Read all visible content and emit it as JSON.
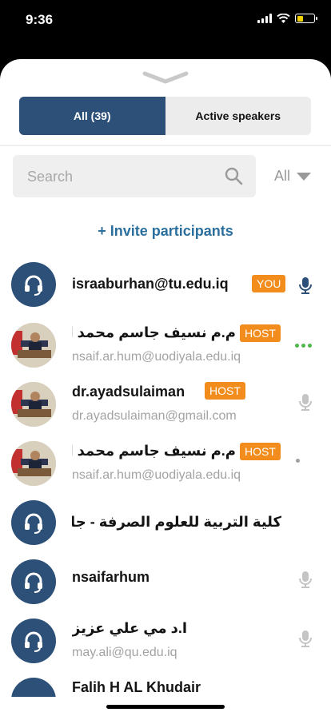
{
  "status": {
    "time": "9:36"
  },
  "tabs": {
    "all": "All  (39)",
    "active": "Active speakers"
  },
  "search": {
    "placeholder": "Search"
  },
  "filter": {
    "label": "All"
  },
  "invite": {
    "label": "+ Invite participants"
  },
  "participants": [
    {
      "name": "israaburhan@tu.edu.iq",
      "email": "",
      "badge": "YOU",
      "status": "mic",
      "avatar": "headset-icon"
    },
    {
      "name": "م.م نسيف جاسم محمد الخفاجي",
      "email": "nsaif.ar.hum@uodiyala.edu.iq",
      "badge": "HOST",
      "status": "speaking",
      "avatar": "photo"
    },
    {
      "name": "dr.ayadsulaiman",
      "email": "dr.ayadsulaiman@gmail.com",
      "badge": "HOST",
      "status": "mic-muted",
      "avatar": "photo"
    },
    {
      "name": "م.م نسيف جاسم محمد الخفاجي",
      "email": "nsaif.ar.hum@uodiyala.edu.iq",
      "badge": "HOST",
      "status": "idle",
      "avatar": "photo"
    },
    {
      "name": "كلية التربية للعلوم الصرفة - جامعة المثنى",
      "email": "",
      "badge": "",
      "status": "none",
      "avatar": "headset-icon"
    },
    {
      "name": "nsaifarhum",
      "email": "",
      "badge": "",
      "status": "mic-muted",
      "avatar": "headset-icon"
    },
    {
      "name": "ا.د مي علي عزيز",
      "email": "may.ali@qu.edu.iq",
      "badge": "",
      "status": "mic-muted",
      "avatar": "headset-icon"
    },
    {
      "name": "Falih H AL Khudair",
      "email": "",
      "badge": "",
      "status": "none",
      "avatar": "headset-icon"
    }
  ],
  "colors": {
    "accent": "#2d5078",
    "link": "#2b6f9e",
    "badge": "#f28c1c",
    "speaking": "#4db54a"
  }
}
